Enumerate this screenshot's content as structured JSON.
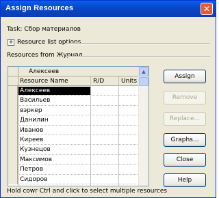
{
  "window": {
    "title": "Assign Resources",
    "close_glyph": "✕"
  },
  "task": {
    "label": "Task: Сбор материалов"
  },
  "resource_options": {
    "expander_glyph": "+",
    "label": "Resource list options"
  },
  "resources_from": {
    "label": "Resources from Журнал"
  },
  "grid": {
    "edit_value": "Алексеев",
    "columns": [
      "Resource Name",
      "R/D",
      "Units"
    ],
    "rows": [
      "Алексеев",
      "Васильев",
      "вэркер",
      "Данилин",
      "Иванов",
      "Киреев",
      "Кузнецов",
      "Максимов",
      "Петров",
      "Сидоров"
    ],
    "selected_row": 0
  },
  "buttons": {
    "assign": "Assign",
    "remove": "Remove",
    "replace": "Replace...",
    "graphs": "Graphs...",
    "close": "Close",
    "help": "Help"
  },
  "footer": {
    "hint": "Hold cowr Ctrl and click to select multiple resources"
  },
  "colors": {
    "titlebar": "#0A5FE9",
    "selection": "#000000",
    "dialog_bg": "#ECE9D8"
  }
}
